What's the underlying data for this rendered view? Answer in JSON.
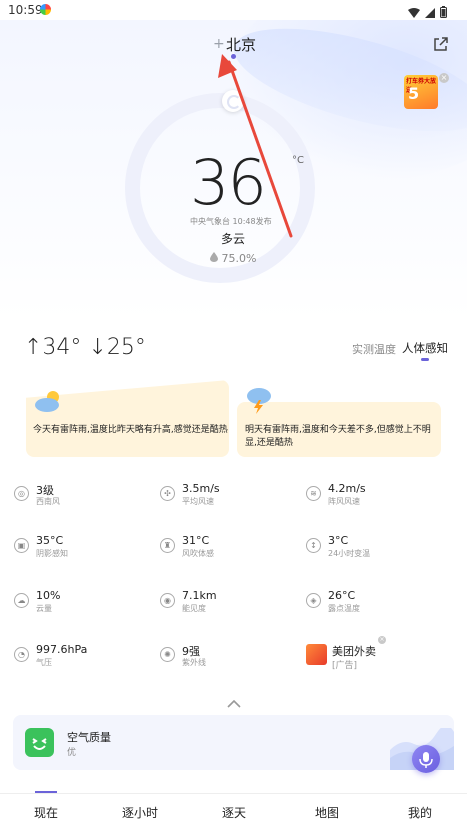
{
  "status_bar": {
    "time": "10:59"
  },
  "header": {
    "add_symbol": "+",
    "city": "北京"
  },
  "ad_top": {
    "text": "打车券大放送",
    "number": "5",
    "close": "×"
  },
  "current": {
    "temperature": "36",
    "unit": "°C",
    "publish": "中央气象台 10:48发布",
    "condition": "多云",
    "humidity": "75.0%"
  },
  "range": {
    "high": "↑34°",
    "low": "↓25°"
  },
  "temp_tabs": {
    "measured": "实测温度",
    "feel": "人体感知"
  },
  "forecast_cards": {
    "today": "今天有雷阵雨,温度比昨天略有升高,感觉还是酷热",
    "tomorrow": "明天有雷阵雨,温度和今天差不多,但感觉上不明显,还是酷热"
  },
  "details": [
    {
      "icon": "compass-icon",
      "glyph": "◎",
      "value": "3级",
      "label": "西南风"
    },
    {
      "icon": "fan-icon",
      "glyph": "✣",
      "value": "3.5m/s",
      "label": "平均风速"
    },
    {
      "icon": "wind-icon",
      "glyph": "≋",
      "value": "4.2m/s",
      "label": "阵风风速"
    },
    {
      "icon": "shade-icon",
      "glyph": "▣",
      "value": "35°C",
      "label": "阴影感知"
    },
    {
      "icon": "person-wind-icon",
      "glyph": "♜",
      "value": "31°C",
      "label": "风吹体感"
    },
    {
      "icon": "thermometer-icon",
      "glyph": "↕",
      "value": "3°C",
      "label": "24小时变温"
    },
    {
      "icon": "cloud-icon",
      "glyph": "☁",
      "value": "10%",
      "label": "云量"
    },
    {
      "icon": "eye-icon",
      "glyph": "◉",
      "value": "7.1km",
      "label": "能见度"
    },
    {
      "icon": "dewdrop-icon",
      "glyph": "◈",
      "value": "26°C",
      "label": "露点温度"
    },
    {
      "icon": "gauge-icon",
      "glyph": "◔",
      "value": "997.6hPa",
      "label": "气压"
    },
    {
      "icon": "uv-icon",
      "glyph": "✺",
      "value": "9强",
      "label": "紫外线"
    }
  ],
  "ad_row": {
    "title": "美团外卖",
    "tag": "[广告]",
    "close": "×"
  },
  "air_quality": {
    "title": "空气质量",
    "value": "优"
  },
  "bottom_nav": [
    "现在",
    "逐小时",
    "逐天",
    "地图",
    "我的"
  ],
  "colors": {
    "accent": "#6b63d9",
    "card": "#fff4dc",
    "aq_green": "#3bc25c",
    "annotation_arrow": "#e8483b"
  }
}
